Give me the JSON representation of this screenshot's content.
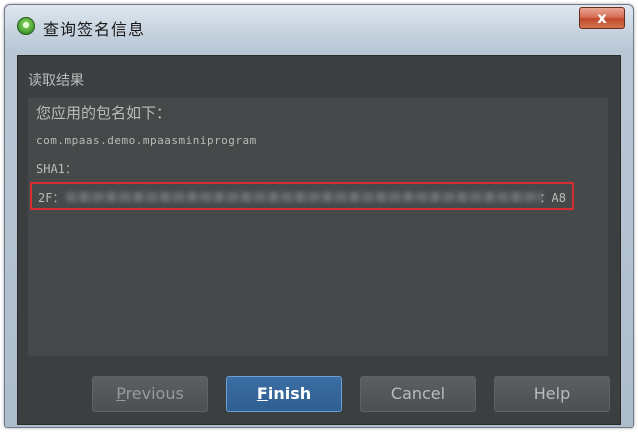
{
  "window": {
    "title": "查询签名信息",
    "close_glyph": "x"
  },
  "section": {
    "title": "读取结果"
  },
  "result": {
    "package_label": "您应用的包名如下：",
    "package_name": "com.mpaas.demo.mpaasminiprogram",
    "sha_label": "SHA1：",
    "sha_prefix": "2F：",
    "sha_suffix": "：A8"
  },
  "buttons": {
    "previous": {
      "mnemonic": "P",
      "rest": "revious"
    },
    "finish": {
      "mnemonic": "F",
      "rest": "inish"
    },
    "cancel": "Cancel",
    "help": "Help"
  },
  "colors": {
    "dialog_bg": "#3c3f41",
    "panel_bg": "#45494a",
    "text": "#bbbbbb",
    "primary_button": "#2f5f91",
    "highlight_border": "#d42e2e",
    "close_button": "#c24a2d"
  }
}
